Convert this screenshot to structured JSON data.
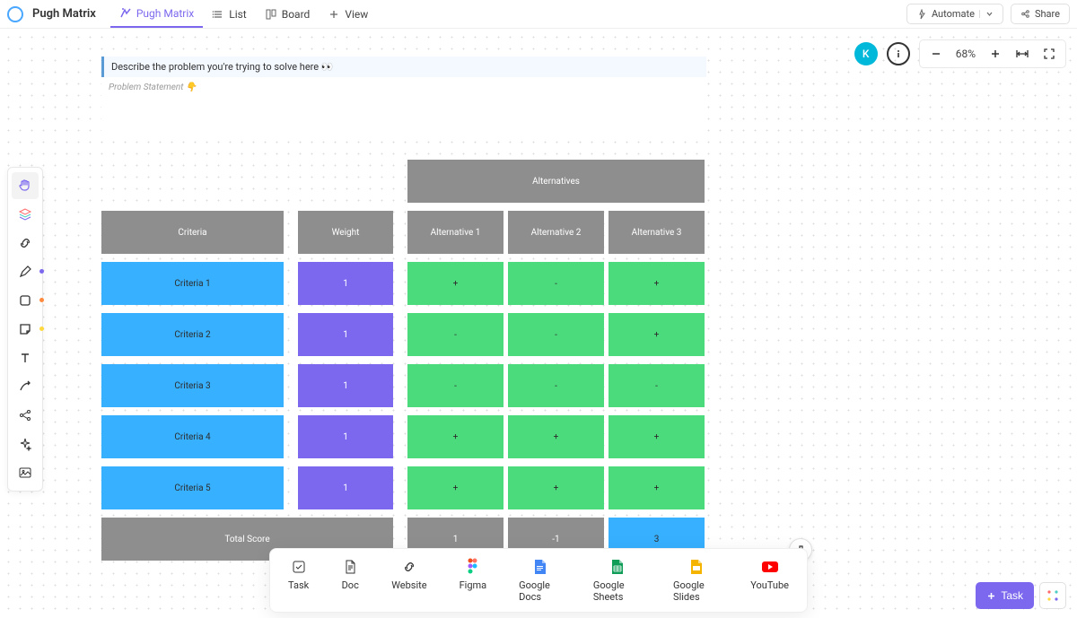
{
  "header": {
    "title": "Pugh Matrix",
    "tabs": [
      {
        "label": "Pugh Matrix",
        "icon": "whiteboard"
      },
      {
        "label": "List",
        "icon": "list"
      },
      {
        "label": "Board",
        "icon": "board"
      },
      {
        "label": "View",
        "icon": "plus"
      }
    ],
    "automate": "Automate",
    "share": "Share"
  },
  "topright": {
    "avatar": "K",
    "zoom": "68%"
  },
  "whiteboard": {
    "callout": "Describe the problem you're trying to solve here 👀",
    "problem_label": "Problem Statement 👇",
    "alternatives_header": "Alternatives",
    "headers": {
      "criteria": "Criteria",
      "weight": "Weight",
      "alt1": "Alternative 1",
      "alt2": "Alternative 2",
      "alt3": "Alternative 3"
    },
    "rows": [
      {
        "criteria": "Criteria 1",
        "weight": "1",
        "a1": "+",
        "a2": "-",
        "a3": "+"
      },
      {
        "criteria": "Criteria 2",
        "weight": "1",
        "a1": "-",
        "a2": "-",
        "a3": "+"
      },
      {
        "criteria": "Criteria 3",
        "weight": "1",
        "a1": "-",
        "a2": "-",
        "a3": "-"
      },
      {
        "criteria": "Criteria 4",
        "weight": "1",
        "a1": "+",
        "a2": "+",
        "a3": "+"
      },
      {
        "criteria": "Criteria 5",
        "weight": "1",
        "a1": "+",
        "a2": "+",
        "a3": "+"
      }
    ],
    "total": {
      "label": "Total Score",
      "a1": "1",
      "a2": "-1",
      "a3": "3"
    }
  },
  "tray": [
    {
      "label": "Task"
    },
    {
      "label": "Doc"
    },
    {
      "label": "Website"
    },
    {
      "label": "Figma"
    },
    {
      "label": "Google Docs"
    },
    {
      "label": "Google Sheets"
    },
    {
      "label": "Google Slides"
    },
    {
      "label": "YouTube"
    }
  ],
  "bottom_right": {
    "task": "Task"
  }
}
